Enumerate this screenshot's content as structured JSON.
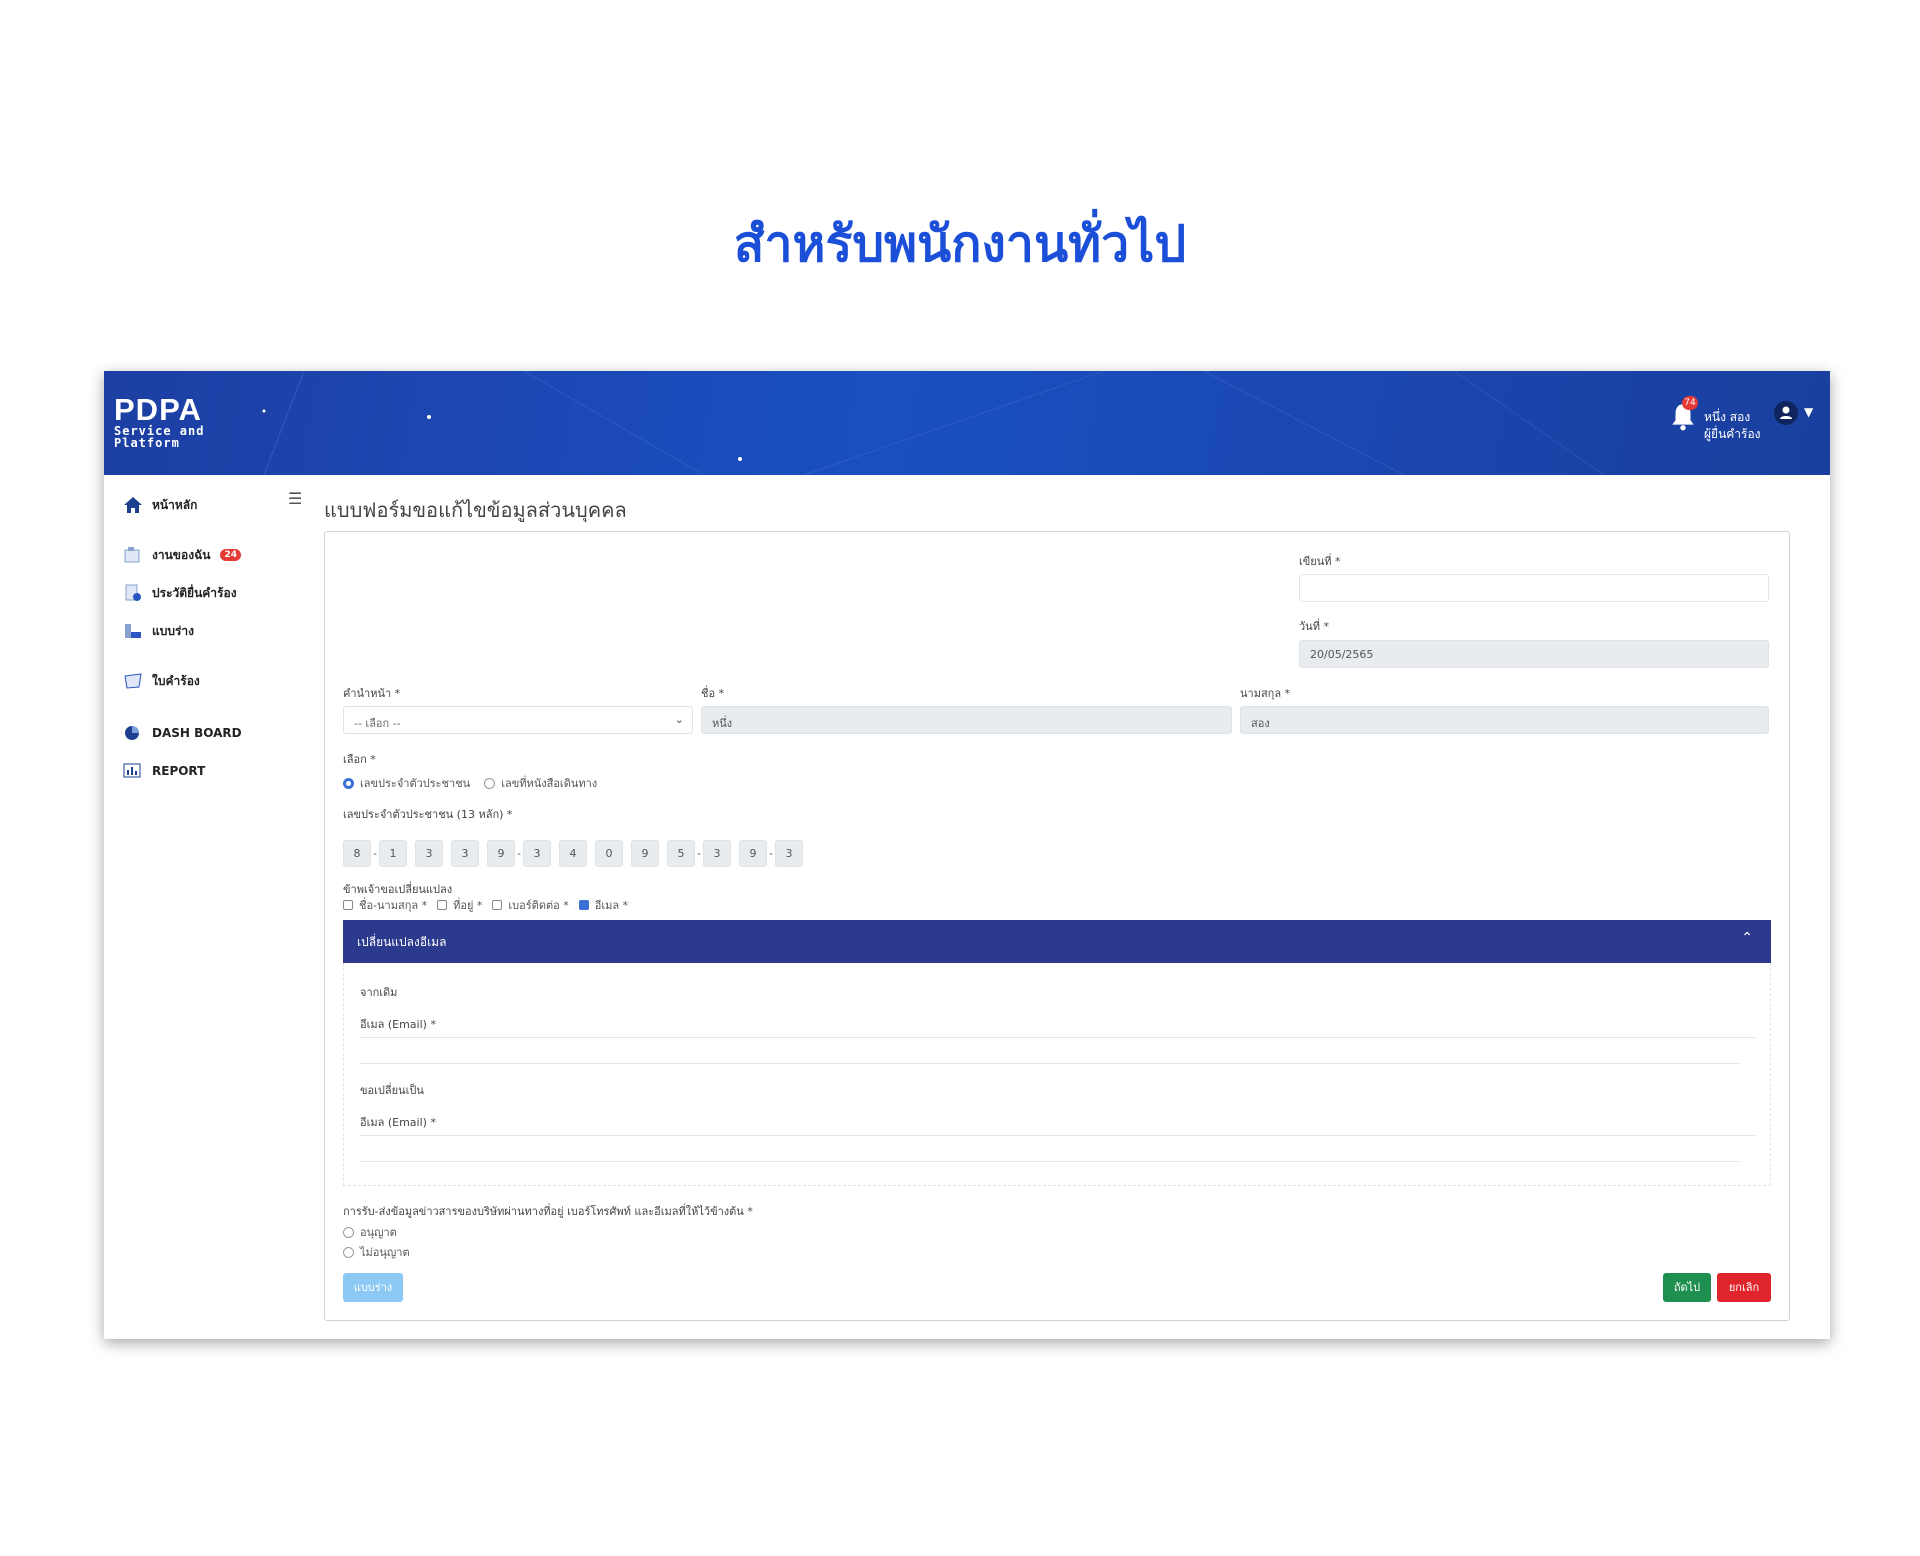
{
  "heading": "สำหรับพนักงานทั่วไป",
  "header": {
    "logo_main": "PDPA",
    "logo_line1": "Service and",
    "logo_line2": "Platform",
    "notification_count": "74",
    "user_line1": "หนึ่ง สอง",
    "user_line2": "ผู้ยื่นคำร้อง",
    "icons": [
      "bell-icon",
      "user-avatar-icon",
      "chevron-down-icon"
    ]
  },
  "sidebar": {
    "items": [
      {
        "label": "หน้าหลัก",
        "icon": "home-icon"
      },
      {
        "label": "งานของฉัน",
        "icon": "task-icon",
        "badge": "24"
      },
      {
        "label": "ประวัติยื่นคำร้อง",
        "icon": "history-icon"
      },
      {
        "label": "แบบร่าง",
        "icon": "draft-icon"
      },
      {
        "label": "ใบคำร้อง",
        "icon": "request-icon"
      },
      {
        "label": "DASH BOARD",
        "icon": "dashboard-icon"
      },
      {
        "label": "REPORT",
        "icon": "report-icon"
      }
    ]
  },
  "page": {
    "title": "แบบฟอร์มขอแก้ไขข้อมูลส่วนบุคคล"
  },
  "form": {
    "written_at_label": "เขียนที่ *",
    "written_at_value": "",
    "date_label": "วันที่ *",
    "date_value": "20/05/2565",
    "prefix_label": "คำนำหน้า *",
    "prefix_value": "-- เลือก --",
    "firstname_label": "ชื่อ *",
    "firstname_value": "หนึ่ง",
    "lastname_label": "นามสกุล *",
    "lastname_value": "สอง",
    "choose_label": "เลือก *",
    "id_options": [
      {
        "label": "เลขประจำตัวประชาชน",
        "selected": true
      },
      {
        "label": "เลขที่หนังสือเดินทาง",
        "selected": false
      }
    ],
    "id_label": "เลขประจำตัวประชาชน (13 หลัก) *",
    "id_digits": [
      "8",
      "1",
      "3",
      "3",
      "9",
      "3",
      "4",
      "0",
      "9",
      "5",
      "3",
      "9",
      "3"
    ],
    "change_label": "ข้าพเจ้าขอเปลี่ยนแปลง",
    "change_options": [
      {
        "label": "ชื่อ-นามสกุล *",
        "checked": false
      },
      {
        "label": "ที่อยู่ *",
        "checked": false
      },
      {
        "label": "เบอร์ติดต่อ *",
        "checked": false
      },
      {
        "label": "อีเมล *",
        "checked": true
      }
    ],
    "panel_title": "เปลี่ยนแปลงอีเมล",
    "from_label": "จากเดิม",
    "email_label_1": "อีเมล (Email) *",
    "to_label": "ขอเปลี่ยนเป็น",
    "email_label_2": "อีเมล (Email) *",
    "consent_label": "การรับ-ส่งข้อมูลข่าวสารของบริษัทผ่านทางที่อยู่ เบอร์โทรศัพท์ และอีเมลที่ให้ไว้ข้างต้น *",
    "consent_options": [
      {
        "label": "อนุญาต",
        "selected": false
      },
      {
        "label": "ไม่อนุญาต",
        "selected": false
      }
    ],
    "draft_button": "แบบร่าง",
    "next_button": "ถัดไป",
    "cancel_button": "ยกเลิก"
  },
  "colors": {
    "heading": "#1b4fd8",
    "header_bg": "#1a4fc2",
    "panel_head": "#2c3a8e",
    "draft_button": "#8cc9f5",
    "next_button": "#1e8f4e",
    "cancel_button": "#e0242c"
  }
}
